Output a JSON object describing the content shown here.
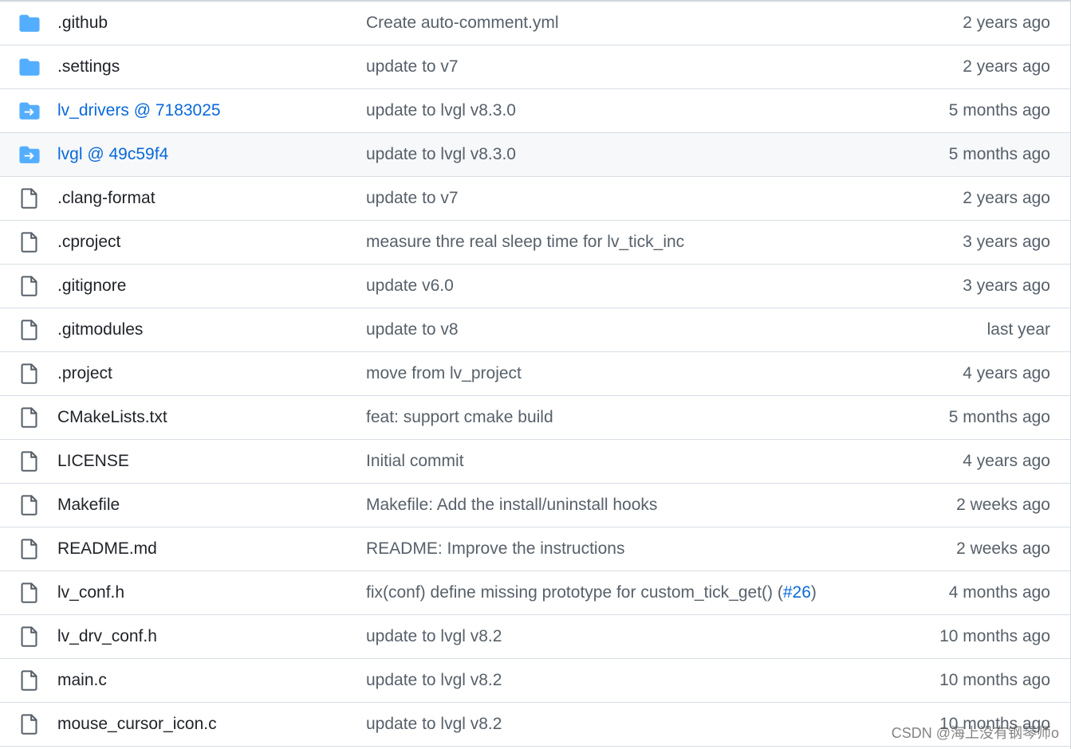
{
  "colors": {
    "folder": "#54aeff",
    "file_icon": "#57606a",
    "link": "#0969da",
    "text": "#1f2328",
    "muted": "#57606a",
    "hover_row": "#f6f8fa"
  },
  "files": [
    {
      "icon": "folder-icon",
      "name": ".github",
      "message": "Create auto-comment.yml",
      "time": "2 years ago"
    },
    {
      "icon": "folder-icon",
      "name": ".settings",
      "message": "update to v7",
      "time": "2 years ago"
    },
    {
      "icon": "submodule-icon",
      "name": "lv_drivers @ 7183025",
      "message": "update to lvgl v8.3.0",
      "time": "5 months ago"
    },
    {
      "icon": "submodule-icon",
      "name": "lvgl @ 49c59f4",
      "message": "update to lvgl v8.3.0",
      "time": "5 months ago"
    },
    {
      "icon": "file-icon",
      "name": ".clang-format",
      "message": "update to v7",
      "time": "2 years ago"
    },
    {
      "icon": "file-icon",
      "name": ".cproject",
      "message": "measure thre real sleep time for lv_tick_inc",
      "time": "3 years ago"
    },
    {
      "icon": "file-icon",
      "name": ".gitignore",
      "message": "update v6.0",
      "time": "3 years ago"
    },
    {
      "icon": "file-icon",
      "name": ".gitmodules",
      "message": "update to v8",
      "time": "last year"
    },
    {
      "icon": "file-icon",
      "name": ".project",
      "message": "move from lv_project",
      "time": "4 years ago"
    },
    {
      "icon": "file-icon",
      "name": "CMakeLists.txt",
      "message": "feat: support cmake build",
      "time": "5 months ago"
    },
    {
      "icon": "file-icon",
      "name": "LICENSE",
      "message": "Initial commit",
      "time": "4 years ago"
    },
    {
      "icon": "file-icon",
      "name": "Makefile",
      "message": "Makefile: Add the install/uninstall hooks",
      "time": "2 weeks ago"
    },
    {
      "icon": "file-icon",
      "name": "README.md",
      "message": "README: Improve the instructions",
      "time": "2 weeks ago"
    },
    {
      "icon": "file-icon",
      "name": "lv_conf.h",
      "message": "fix(conf) define missing prototype for custom_tick_get() (",
      "message_pr": "#26",
      "message_tail": ")",
      "time": "4 months ago"
    },
    {
      "icon": "file-icon",
      "name": "lv_drv_conf.h",
      "message": "update to lvgl v8.2",
      "time": "10 months ago"
    },
    {
      "icon": "file-icon",
      "name": "main.c",
      "message": "update to lvgl v8.2",
      "time": "10 months ago"
    },
    {
      "icon": "file-icon",
      "name": "mouse_cursor_icon.c",
      "message": "update to lvgl v8.2",
      "time": "10 months ago"
    }
  ],
  "watermark": "CSDN @海上没有钢琴师o"
}
